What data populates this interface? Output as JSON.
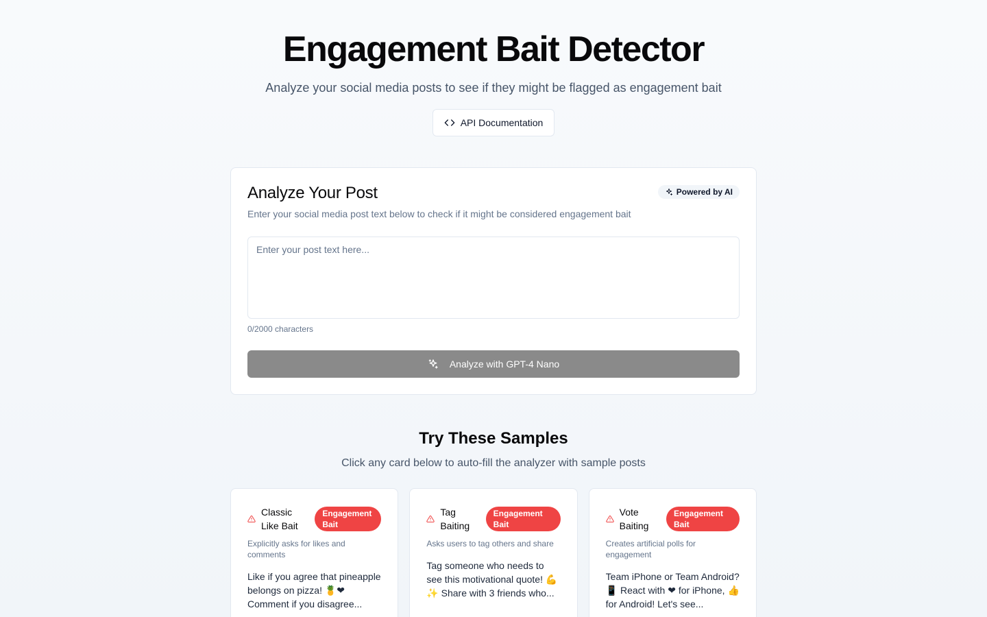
{
  "header": {
    "title": "Engagement Bait Detector",
    "subtitle": "Analyze your social media posts to see if they might be flagged as engagement bait",
    "api_button_label": "API Documentation"
  },
  "analyzer": {
    "title": "Analyze Your Post",
    "badge": "Powered by AI",
    "description": "Enter your social media post text below to check if it might be considered engagement bait",
    "input_placeholder": "Enter your post text here...",
    "input_value": "",
    "char_count": "0/2000 characters",
    "submit_label": "Analyze with GPT-4 Nano"
  },
  "samples": {
    "title": "Try These Samples",
    "subtitle": "Click any card below to auto-fill the analyzer with sample posts",
    "items": [
      {
        "name": "Classic Like Bait",
        "badge": "Engagement Bait",
        "description": "Explicitly asks for likes and comments",
        "text": "Like if you agree that pineapple belongs on pizza! 🍍❤ Comment if you disagree..."
      },
      {
        "name": "Tag Baiting",
        "badge": "Engagement Bait",
        "description": "Asks users to tag others and share",
        "text": "Tag someone who needs to see this motivational quote! 💪✨ Share with 3 friends who..."
      },
      {
        "name": "Vote Baiting",
        "badge": "Engagement Bait",
        "description": "Creates artificial polls for engagement",
        "text": "Team iPhone or Team Android? 📱 React with ❤ for iPhone, 👍 for Android! Let's see..."
      }
    ]
  },
  "colors": {
    "badge_red": "#ef4444",
    "disabled_button": "#8a8a8a",
    "border": "#e2e8f0"
  }
}
